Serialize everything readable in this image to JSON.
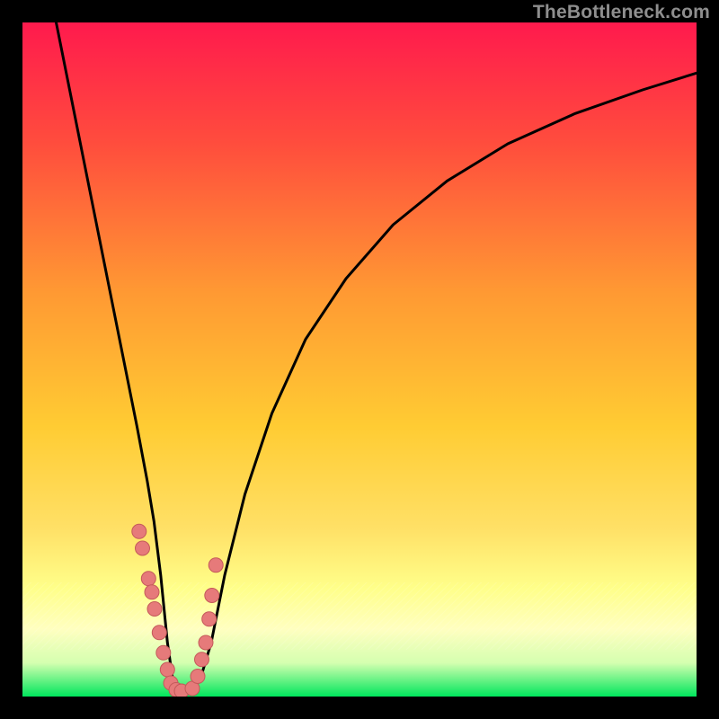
{
  "watermark": "TheBottleneck.com",
  "colors": {
    "frame": "#000000",
    "top": "#ff1a4d",
    "mid_upper": "#ff7a33",
    "mid": "#ffc933",
    "mid_lower": "#ffe066",
    "yellow_pale": "#ffff99",
    "green": "#00e65c",
    "curve": "#000000",
    "bead": "#e67a7a",
    "bead_stroke": "#c45a5a"
  },
  "chart_data": {
    "type": "line",
    "title": "",
    "xlabel": "",
    "ylabel": "",
    "xlim": [
      0,
      100
    ],
    "ylim": [
      0,
      100
    ],
    "series": [
      {
        "name": "curve",
        "x": [
          5,
          7,
          9,
          11,
          13,
          15,
          17,
          18.5,
          19.5,
          20.5,
          21.5,
          22.5,
          23.5,
          25,
          26.5,
          28,
          30,
          33,
          37,
          42,
          48,
          55,
          63,
          72,
          82,
          92,
          100
        ],
        "y": [
          100,
          90,
          80,
          70,
          60,
          50,
          40,
          32,
          26,
          18,
          8,
          1,
          0.5,
          0.5,
          3,
          8,
          18,
          30,
          42,
          53,
          62,
          70,
          76.5,
          82,
          86.5,
          90,
          92.5
        ]
      }
    ],
    "beads": {
      "name": "beads",
      "x": [
        17.3,
        17.8,
        18.7,
        19.2,
        19.6,
        20.3,
        20.9,
        21.5,
        22.0,
        22.8,
        23.6,
        25.2,
        26.0,
        26.6,
        27.2,
        27.7,
        28.1,
        28.7
      ],
      "y": [
        24.5,
        22.0,
        17.5,
        15.5,
        13.0,
        9.5,
        6.5,
        4.0,
        2.0,
        1.0,
        0.8,
        1.2,
        3.0,
        5.5,
        8.0,
        11.5,
        15.0,
        19.5
      ]
    },
    "gradient_stops": [
      {
        "pct": 0,
        "color": "#ff1a4d"
      },
      {
        "pct": 18,
        "color": "#ff4d3d"
      },
      {
        "pct": 40,
        "color": "#ff9933"
      },
      {
        "pct": 60,
        "color": "#ffcc33"
      },
      {
        "pct": 75,
        "color": "#ffe066"
      },
      {
        "pct": 84,
        "color": "#ffff8a"
      },
      {
        "pct": 90,
        "color": "#ffffc0"
      },
      {
        "pct": 95,
        "color": "#d5ffb0"
      },
      {
        "pct": 100,
        "color": "#00e65c"
      }
    ],
    "hatch_band": {
      "from_pct": 83,
      "to_pct": 93
    }
  }
}
